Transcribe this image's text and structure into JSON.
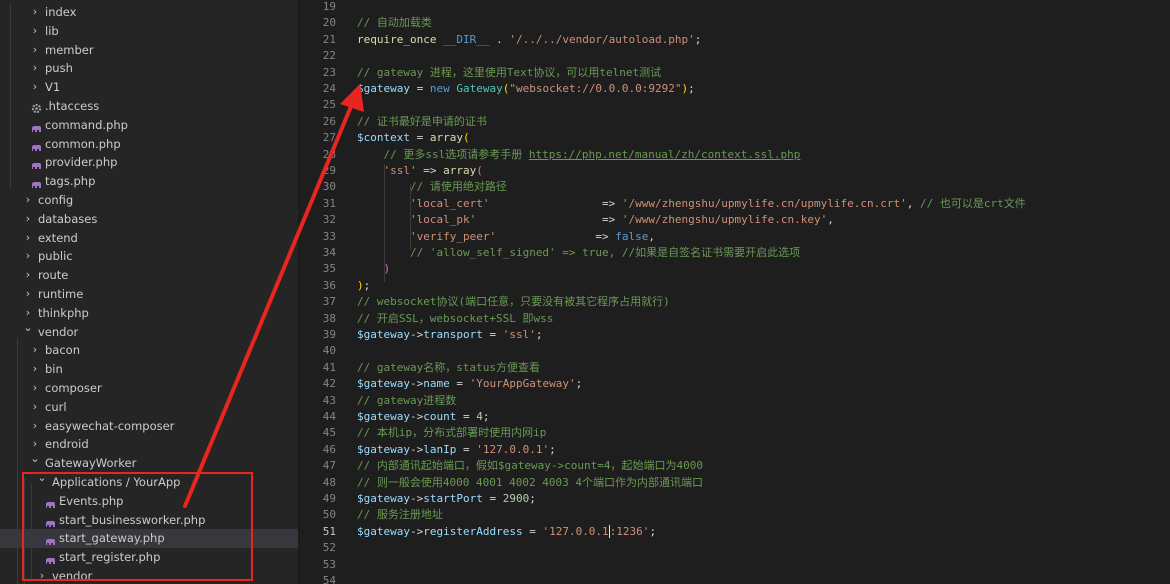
{
  "explorer": {
    "items": [
      {
        "label": "index",
        "kind": "folder",
        "expanded": false,
        "depth": 1
      },
      {
        "label": "lib",
        "kind": "folder",
        "expanded": false,
        "depth": 1
      },
      {
        "label": "member",
        "kind": "folder",
        "expanded": false,
        "depth": 1
      },
      {
        "label": "push",
        "kind": "folder",
        "expanded": false,
        "depth": 1
      },
      {
        "label": "V1",
        "kind": "folder",
        "expanded": false,
        "depth": 1
      },
      {
        "label": ".htaccess",
        "kind": "gear",
        "depth": 1
      },
      {
        "label": "command.php",
        "kind": "php",
        "depth": 1
      },
      {
        "label": "common.php",
        "kind": "php",
        "depth": 1
      },
      {
        "label": "provider.php",
        "kind": "php",
        "depth": 1
      },
      {
        "label": "tags.php",
        "kind": "php",
        "depth": 1
      },
      {
        "label": "config",
        "kind": "folder",
        "expanded": false,
        "depth": 0
      },
      {
        "label": "databases",
        "kind": "folder",
        "expanded": false,
        "depth": 0
      },
      {
        "label": "extend",
        "kind": "folder",
        "expanded": false,
        "depth": 0
      },
      {
        "label": "public",
        "kind": "folder",
        "expanded": false,
        "depth": 0
      },
      {
        "label": "route",
        "kind": "folder",
        "expanded": false,
        "depth": 0
      },
      {
        "label": "runtime",
        "kind": "folder",
        "expanded": false,
        "depth": 0
      },
      {
        "label": "thinkphp",
        "kind": "folder",
        "expanded": false,
        "depth": 0
      },
      {
        "label": "vendor",
        "kind": "folder",
        "expanded": true,
        "depth": 0
      },
      {
        "label": "bacon",
        "kind": "folder",
        "expanded": false,
        "depth": 1
      },
      {
        "label": "bin",
        "kind": "folder",
        "expanded": false,
        "depth": 1
      },
      {
        "label": "composer",
        "kind": "folder",
        "expanded": false,
        "depth": 1
      },
      {
        "label": "curl",
        "kind": "folder",
        "expanded": false,
        "depth": 1
      },
      {
        "label": "easywechat-composer",
        "kind": "folder",
        "expanded": false,
        "depth": 1
      },
      {
        "label": "endroid",
        "kind": "folder",
        "expanded": false,
        "depth": 1
      },
      {
        "label": "GatewayWorker",
        "kind": "folder",
        "expanded": true,
        "depth": 1
      },
      {
        "label": "Applications / YourApp",
        "kind": "folder",
        "expanded": true,
        "depth": 2
      },
      {
        "label": "Events.php",
        "kind": "php",
        "depth": 3
      },
      {
        "label": "start_businessworker.php",
        "kind": "php",
        "depth": 3
      },
      {
        "label": "start_gateway.php",
        "kind": "php",
        "depth": 3,
        "selected": true
      },
      {
        "label": "start_register.php",
        "kind": "php",
        "depth": 3
      },
      {
        "label": "vendor",
        "kind": "folder",
        "expanded": false,
        "depth": 2
      }
    ]
  },
  "editor": {
    "current_line": 51,
    "lines": [
      {
        "n": "19",
        "t": []
      },
      {
        "n": "20",
        "t": [
          [
            "c",
            "// 自动加载类"
          ]
        ]
      },
      {
        "n": "21",
        "t": [
          [
            "k",
            "require_once"
          ],
          [
            "p",
            " "
          ],
          [
            "b",
            "__DIR__"
          ],
          [
            "p",
            " . "
          ],
          [
            "s",
            "'/../../vendor/autoload.php'"
          ],
          [
            "p",
            ";"
          ]
        ]
      },
      {
        "n": "22",
        "t": []
      },
      {
        "n": "23",
        "t": [
          [
            "c",
            "// gateway 进程，这里使用Text协议，可以用telnet测试"
          ]
        ]
      },
      {
        "n": "24",
        "t": [
          [
            "v",
            "$gateway"
          ],
          [
            "p",
            " = "
          ],
          [
            "b",
            "new"
          ],
          [
            "p",
            " "
          ],
          [
            "t",
            "Gateway"
          ],
          [
            "y",
            "("
          ],
          [
            "s",
            "\"websocket://0.0.0.0:9292\""
          ],
          [
            "y",
            ")"
          ],
          [
            "p",
            ";"
          ]
        ]
      },
      {
        "n": "25",
        "t": []
      },
      {
        "n": "26",
        "t": [
          [
            "c",
            "// 证书最好是申请的证书"
          ]
        ]
      },
      {
        "n": "27",
        "t": [
          [
            "v",
            "$context"
          ],
          [
            "p",
            " = "
          ],
          [
            "k",
            "array"
          ],
          [
            "y",
            "("
          ]
        ]
      },
      {
        "n": "28",
        "t": [
          [
            "p",
            "    "
          ],
          [
            "c",
            "// 更多ssl选项请参考手册 "
          ],
          [
            "u",
            "https://php.net/manual/zh/context.ssl.php"
          ]
        ]
      },
      {
        "n": "29",
        "t": [
          [
            "p",
            "    "
          ],
          [
            "s",
            "'ssl'"
          ],
          [
            "p",
            " => "
          ],
          [
            "k",
            "array"
          ],
          [
            "m",
            "("
          ]
        ]
      },
      {
        "n": "30",
        "t": [
          [
            "p",
            "        "
          ],
          [
            "c",
            "// 请使用绝对路径"
          ]
        ]
      },
      {
        "n": "31",
        "t": [
          [
            "p",
            "        "
          ],
          [
            "s",
            "'local_cert'"
          ],
          [
            "p",
            "                 => "
          ],
          [
            "s",
            "'/www/zhengshu/upmylife.cn/upmylife.cn.crt'"
          ],
          [
            "p",
            ", "
          ],
          [
            "c",
            "// 也可以是crt文件"
          ]
        ]
      },
      {
        "n": "32",
        "t": [
          [
            "p",
            "        "
          ],
          [
            "s",
            "'local_pk'"
          ],
          [
            "p",
            "                   => "
          ],
          [
            "s",
            "'/www/zhengshu/upmylife.cn.key'"
          ],
          [
            "p",
            ","
          ]
        ]
      },
      {
        "n": "33",
        "t": [
          [
            "p",
            "        "
          ],
          [
            "s",
            "'verify_peer'"
          ],
          [
            "p",
            "               => "
          ],
          [
            "b",
            "false"
          ],
          [
            "p",
            ","
          ]
        ]
      },
      {
        "n": "34",
        "t": [
          [
            "p",
            "        "
          ],
          [
            "c",
            "// 'allow_self_signed' => true, //如果是自签名证书需要开启此选项"
          ]
        ]
      },
      {
        "n": "35",
        "t": [
          [
            "p",
            "    "
          ],
          [
            "m",
            ")"
          ]
        ]
      },
      {
        "n": "36",
        "t": [
          [
            "y",
            ")"
          ],
          [
            "p",
            ";"
          ]
        ]
      },
      {
        "n": "37",
        "t": [
          [
            "c",
            "// websocket协议(端口任意，只要没有被其它程序占用就行)"
          ]
        ]
      },
      {
        "n": "38",
        "t": [
          [
            "c",
            "// 开启SSL，websocket+SSL 即wss"
          ]
        ]
      },
      {
        "n": "39",
        "t": [
          [
            "v",
            "$gateway"
          ],
          [
            "p",
            "->"
          ],
          [
            "v",
            "transport"
          ],
          [
            "p",
            " = "
          ],
          [
            "s",
            "'ssl'"
          ],
          [
            "p",
            ";"
          ]
        ]
      },
      {
        "n": "40",
        "t": []
      },
      {
        "n": "41",
        "t": [
          [
            "c",
            "// gateway名称，status方便查看"
          ]
        ]
      },
      {
        "n": "42",
        "t": [
          [
            "v",
            "$gateway"
          ],
          [
            "p",
            "->"
          ],
          [
            "v",
            "name"
          ],
          [
            "p",
            " = "
          ],
          [
            "s",
            "'YourAppGateway'"
          ],
          [
            "p",
            ";"
          ]
        ]
      },
      {
        "n": "43",
        "t": [
          [
            "c",
            "// gateway进程数"
          ]
        ]
      },
      {
        "n": "44",
        "t": [
          [
            "v",
            "$gateway"
          ],
          [
            "p",
            "->"
          ],
          [
            "v",
            "count"
          ],
          [
            "p",
            " = "
          ],
          [
            "n",
            "4"
          ],
          [
            "p",
            ";"
          ]
        ]
      },
      {
        "n": "45",
        "t": [
          [
            "c",
            "// 本机ip，分布式部署时使用内网ip"
          ]
        ]
      },
      {
        "n": "46",
        "t": [
          [
            "v",
            "$gateway"
          ],
          [
            "p",
            "->"
          ],
          [
            "v",
            "lanIp"
          ],
          [
            "p",
            " = "
          ],
          [
            "s",
            "'127.0.0.1'"
          ],
          [
            "p",
            ";"
          ]
        ]
      },
      {
        "n": "47",
        "t": [
          [
            "c",
            "// 内部通讯起始端口，假如$gateway->count=4，起始端口为4000"
          ]
        ]
      },
      {
        "n": "48",
        "t": [
          [
            "c",
            "// 则一般会使用4000 4001 4002 4003 4个端口作为内部通讯端口"
          ]
        ]
      },
      {
        "n": "49",
        "t": [
          [
            "v",
            "$gateway"
          ],
          [
            "p",
            "->"
          ],
          [
            "v",
            "startPort"
          ],
          [
            "p",
            " = "
          ],
          [
            "n",
            "2900"
          ],
          [
            "p",
            ";"
          ]
        ]
      },
      {
        "n": "50",
        "t": [
          [
            "c",
            "// 服务注册地址"
          ]
        ]
      },
      {
        "n": "51",
        "t": [
          [
            "v",
            "$gateway"
          ],
          [
            "p",
            "->"
          ],
          [
            "v",
            "registerAddress"
          ],
          [
            "p",
            " = "
          ],
          [
            "s",
            "'127.0.0.1"
          ],
          [
            "cursor",
            ""
          ],
          [
            "s",
            ":1236'"
          ],
          [
            "p",
            ";"
          ]
        ]
      },
      {
        "n": "52",
        "t": []
      },
      {
        "n": "53",
        "t": []
      },
      {
        "n": "54",
        "t": []
      }
    ]
  },
  "annotation": {
    "color": "#e8261f"
  }
}
